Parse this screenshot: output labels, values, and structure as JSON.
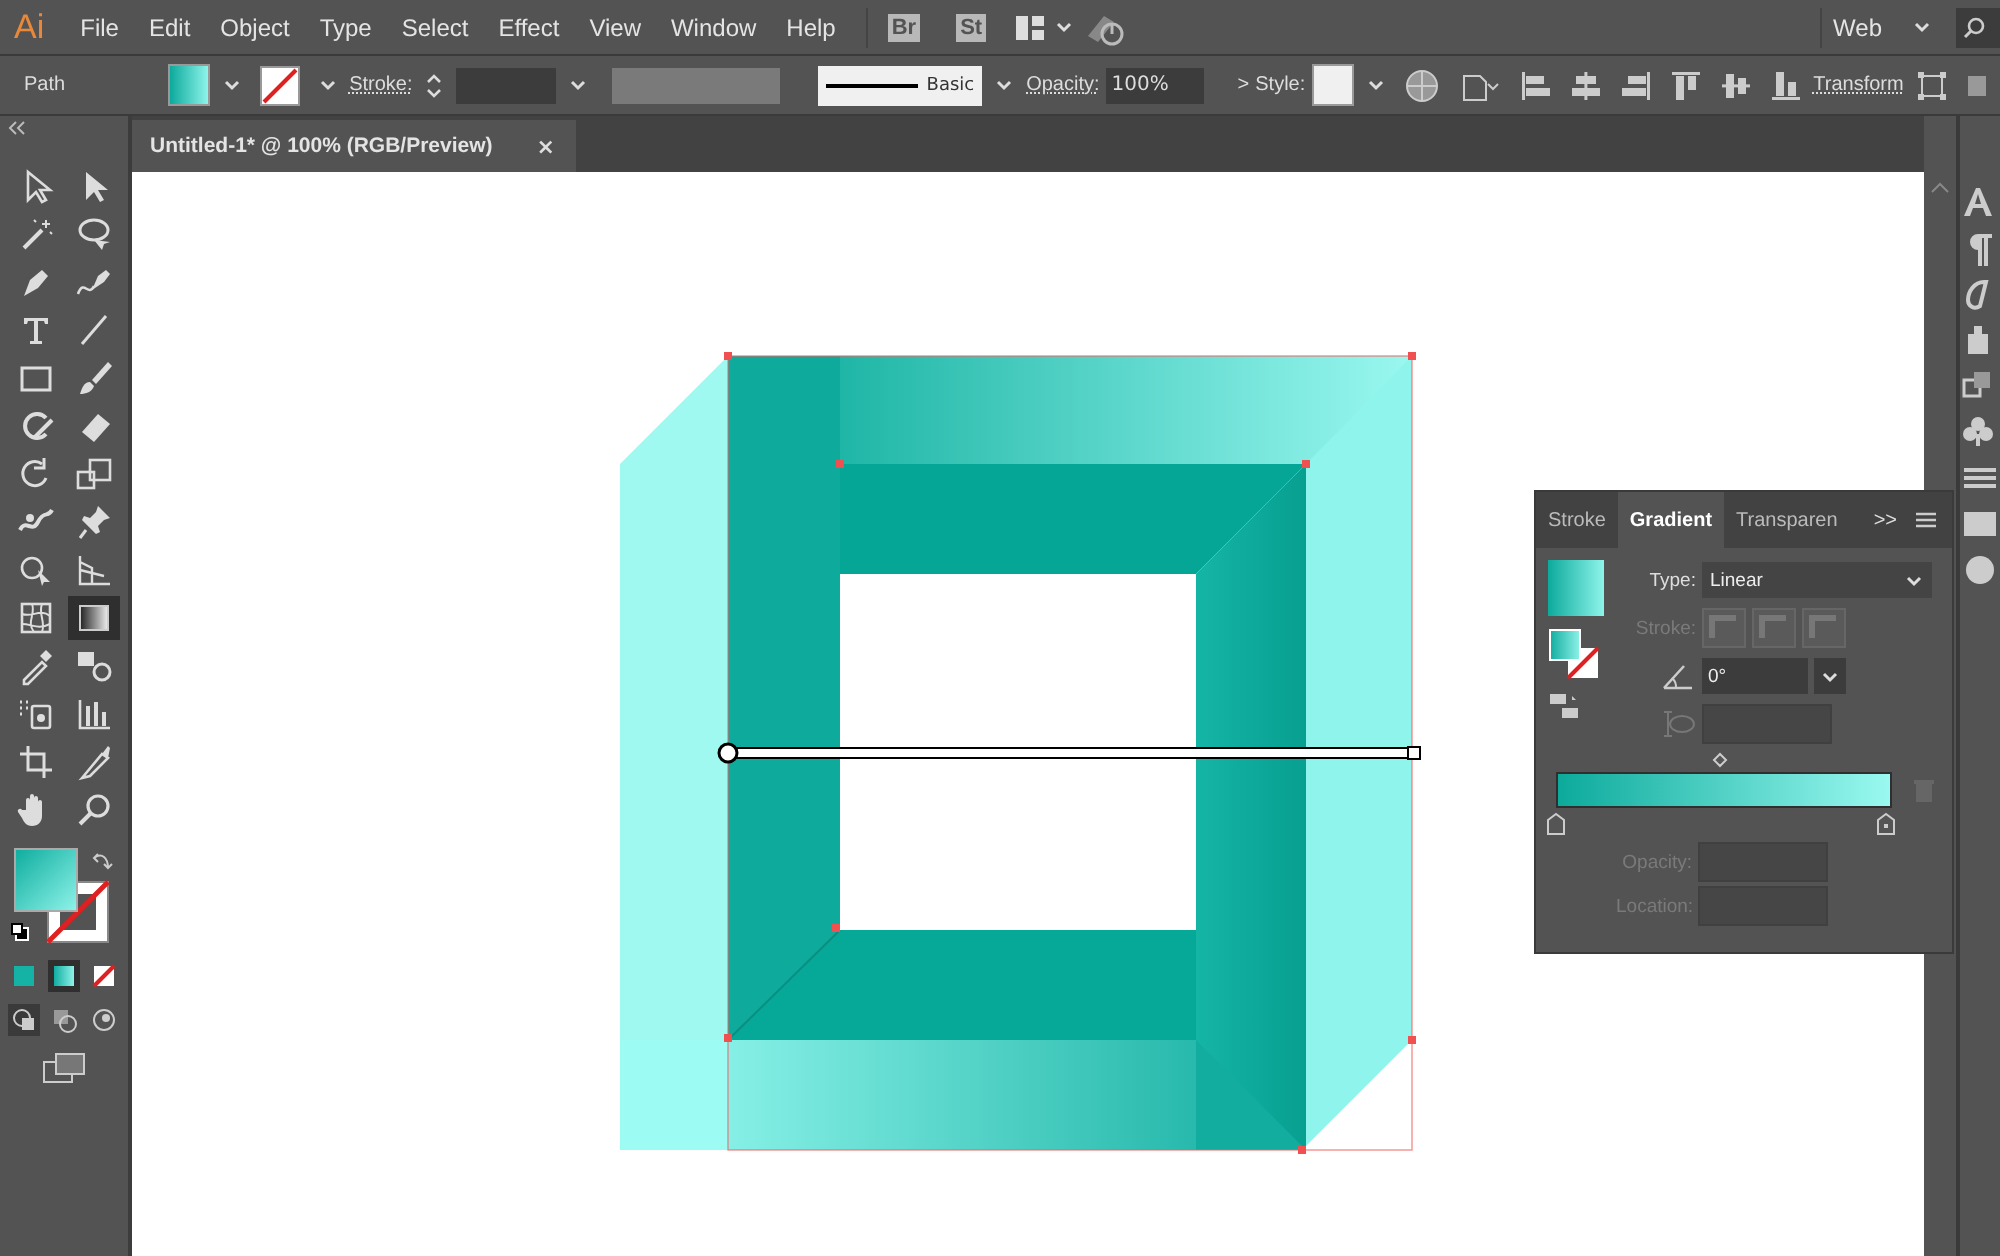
{
  "app": {
    "logo": "Ai",
    "menus": [
      "File",
      "Edit",
      "Object",
      "Type",
      "Select",
      "Effect",
      "View",
      "Window",
      "Help"
    ],
    "bridge": "Br",
    "stock": "St",
    "workspace": "Web"
  },
  "control_bar": {
    "selection": "Path",
    "stroke_label": "Stroke:",
    "stroke_profile": "Basic",
    "opacity_label": "Opacity:",
    "opacity": "100%",
    "opacity_more": ">",
    "style_label": "Style:",
    "transform": "Transform"
  },
  "document_tab": {
    "title": "Untitled-1* @ 100% (RGB/Preview)",
    "close": "×"
  },
  "tools": [
    {
      "selected": false
    },
    {
      "selected": false
    },
    {
      "selected": false
    },
    {
      "selected": false
    },
    {
      "selected": false
    },
    {
      "selected": false
    },
    {
      "selected": false
    },
    {
      "selected": false
    },
    {
      "selected": false
    },
    {
      "selected": false
    },
    {
      "selected": false
    },
    {
      "selected": false
    },
    {
      "selected": false
    },
    {
      "selected": false
    },
    {
      "selected": false
    },
    {
      "selected": false
    },
    {
      "selected": false
    },
    {
      "selected": false
    },
    {
      "selected": false
    },
    {
      "selected": true
    },
    {
      "selected": false
    },
    {
      "selected": false
    },
    {
      "selected": false
    },
    {
      "selected": false
    },
    {
      "selected": false
    },
    {
      "selected": false
    },
    {
      "selected": false
    },
    {
      "selected": false
    }
  ],
  "color_modes": [
    {
      "kind": "color",
      "selected": false
    },
    {
      "kind": "gradient",
      "selected": true
    },
    {
      "kind": "none",
      "selected": false
    }
  ],
  "gradient_panel": {
    "tabs": [
      {
        "label": "Stroke",
        "selected": false
      },
      {
        "label": "Gradient",
        "selected": true
      },
      {
        "label": "Transparen",
        "selected": false
      }
    ],
    "overflow": ">>",
    "type_label": "Type:",
    "type": "Linear",
    "stroke_label": "Stroke:",
    "angle": "0°",
    "opacity_label": "Opacity:",
    "location_label": "Location:"
  }
}
